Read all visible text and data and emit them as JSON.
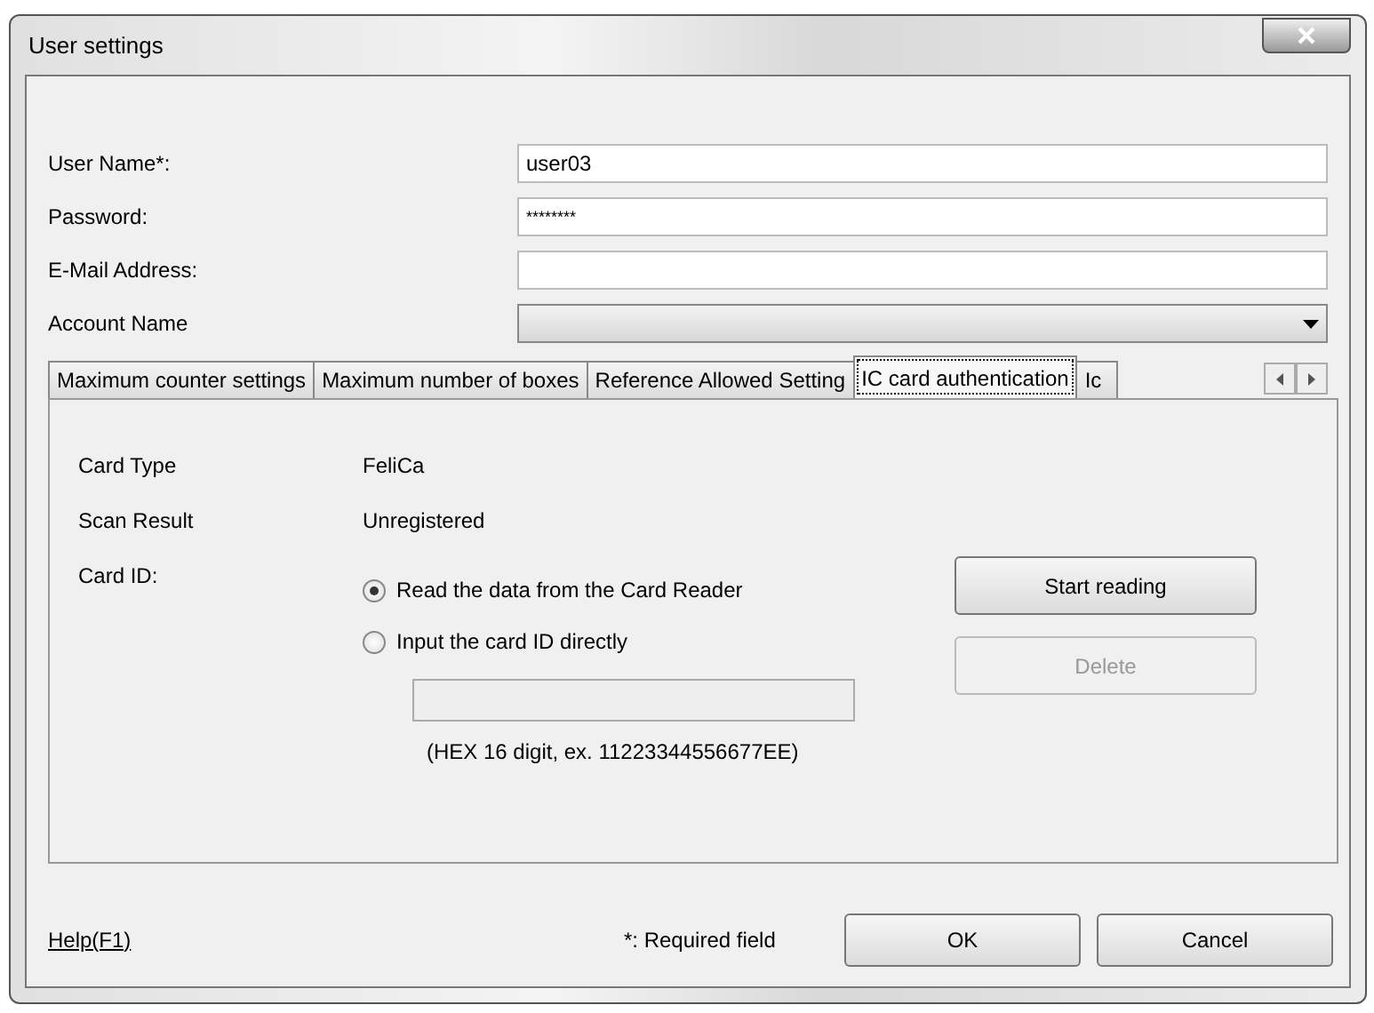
{
  "window": {
    "title": "User settings"
  },
  "fields": [
    {
      "label": "User Name*:",
      "kind": "text",
      "value": "user03"
    },
    {
      "label": "Password:",
      "kind": "password",
      "value": "********"
    },
    {
      "label": "E-Mail Address:",
      "kind": "text"
    },
    {
      "label": "Account Name",
      "kind": "dropdown"
    }
  ],
  "tabs": [
    {
      "label": "Maximum counter settings",
      "selected": false
    },
    {
      "label": "Maximum number of boxes",
      "selected": false
    },
    {
      "label": "Reference Allowed Setting",
      "selected": false
    },
    {
      "label": "IC card authentication",
      "selected": true
    },
    {
      "label": "Ic",
      "selected": false
    }
  ],
  "card": {
    "rows": [
      {
        "label": "Card Type",
        "value": "FeliCa"
      },
      {
        "label": "Scan Result",
        "value": "Unregistered"
      }
    ],
    "id_label": "Card ID:",
    "options": [
      {
        "label": "Read the data from the Card Reader",
        "selected": true
      },
      {
        "label": "Input the card ID directly",
        "selected": false
      }
    ],
    "id_field": {
      "disabled": true
    },
    "hint": "(HEX 16 digit, ex. 11223344556677EE)",
    "buttons": [
      {
        "label": "Start reading",
        "disabled": false
      },
      {
        "label": "Delete",
        "disabled": true
      }
    ]
  },
  "footer": {
    "help": "Help(F1)",
    "note": "*: Required field",
    "buttons": [
      "OK",
      "Cancel"
    ]
  }
}
